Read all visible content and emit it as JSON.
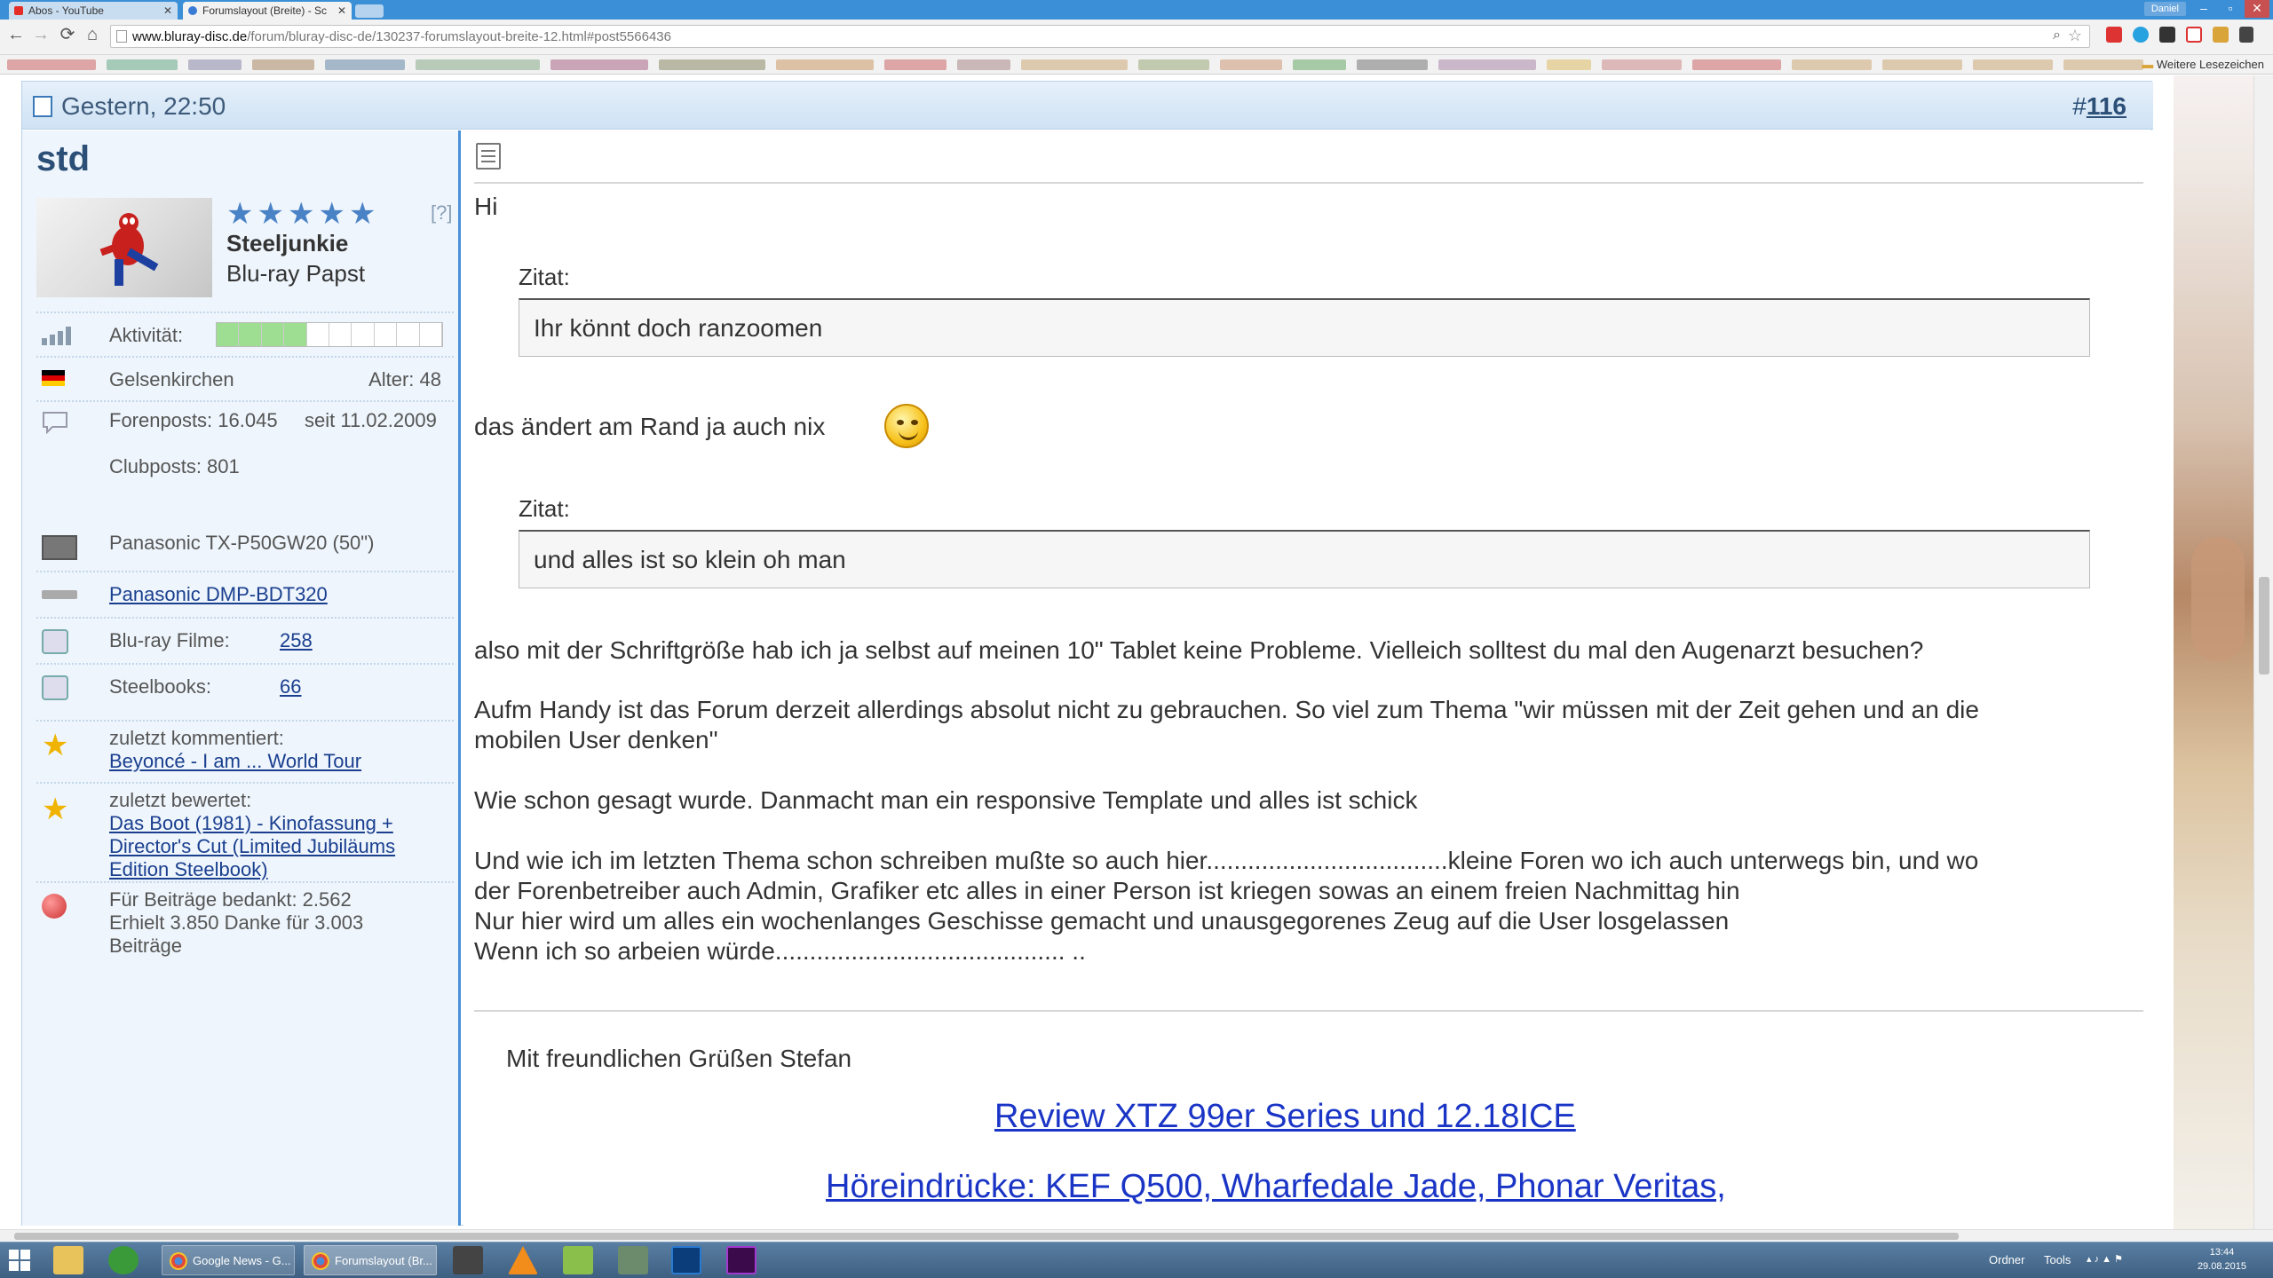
{
  "browser": {
    "tabs": [
      {
        "title": "Abos - YouTube"
      },
      {
        "title": "Forumslayout (Breite) - Sc"
      }
    ],
    "user": "Daniel",
    "controls": {
      "minimize": "–",
      "restore": "▫",
      "close": "✕"
    },
    "nav": {
      "back": "←",
      "forward": "→",
      "reload": "⟳",
      "home": "⌂"
    },
    "url_host": "www.bluray-disc.de",
    "url_path": "/forum/bluray-disc-de/130237-forumslayout-breite-12.html#post5566436",
    "bookmarks_more": "Weitere Lesezeichen"
  },
  "post": {
    "date": "Gestern, 22:50",
    "number_prefix": "#",
    "number": "116"
  },
  "user": {
    "name": "std",
    "stars_help": "[?]",
    "rank_title": "Steeljunkie",
    "rank_subtitle": "Blu-ray Papst",
    "activity_label": "Aktivität:",
    "activity_level_fraction": 0.4,
    "location": "Gelsenkirchen",
    "age": "Alter: 48",
    "forum_posts": "Forenposts: 16.045",
    "member_since": "seit 11.02.2009",
    "club_posts": "Clubposts: 801",
    "tv": "Panasonic TX-P50GW20 (50\")",
    "player": "Panasonic DMP-BDT320",
    "bluray_label": "Blu-ray Filme:",
    "bluray_count": "258",
    "steelbooks_label": "Steelbooks:",
    "steelbooks_count": "66",
    "last_commented_label": "zuletzt kommentiert:",
    "last_commented": "Beyoncé - I am ... World Tour",
    "last_rated_label": "zuletzt bewertet:",
    "last_rated": [
      "Das Boot (1981) - Kinofassung +",
      "Director's Cut (Limited Jubiläums",
      "Edition Steelbook)"
    ],
    "thanks_given": "Für Beiträge bedankt: 2.562",
    "thanks_received": [
      "Erhielt 3.850 Danke für 3.003",
      "Beiträge"
    ]
  },
  "content": {
    "greeting": "Hi",
    "quote_label": "Zitat:",
    "quote1": "Ihr könnt doch ranzoomen",
    "line1": "das ändert am Rand ja auch nix",
    "quote2": "und alles ist so klein oh man",
    "paragraph1": "also mit der Schriftgröße hab ich ja selbst auf meinen 10\" Tablet keine Probleme. Vielleich solltest du mal den Augenarzt besuchen?",
    "paragraph2": [
      "Aufm Handy ist das Forum derzeit allerdings absolut nicht zu gebrauchen. So viel zum Thema \"wir müssen mit der Zeit gehen und an die",
      "mobilen User denken\""
    ],
    "paragraph3": "Wie schon gesagt wurde. Danmacht man ein responsive Template und alles ist schick",
    "paragraph4": [
      "Und wie ich im letzten Thema schon schreiben mußte so auch hier...................................kleine Foren wo ich auch unterwegs bin, und wo",
      "der Forenbetreiber auch Admin, Grafiker etc alles in einer Person ist kriegen sowas an einem freien Nachmittag hin",
      "Nur hier wird um alles ein wochenlanges Geschisse gemacht und unausgegorenes Zeug auf die User losgelassen",
      "Wenn ich so arbeien würde.......................................... .."
    ],
    "signature": "Mit freundlichen Grüßen Stefan",
    "sig_link1": "Review XTZ 99er Series und 12.18ICE",
    "sig_link2": "Höreindrücke: KEF Q500, Wharfedale Jade, Phonar Veritas,"
  },
  "taskbar": {
    "tasks": [
      "Google News - G...",
      "Forumslayout (Br..."
    ],
    "tray_folder": "Ordner",
    "tray_tools": "Tools",
    "time": "13:44",
    "date": "29.08.2015"
  },
  "colors": {
    "accent": "#4a90d9",
    "link": "#1a35c6",
    "header_bg": "#cfe2f4",
    "sidebar_bg": "#eef5fc"
  }
}
